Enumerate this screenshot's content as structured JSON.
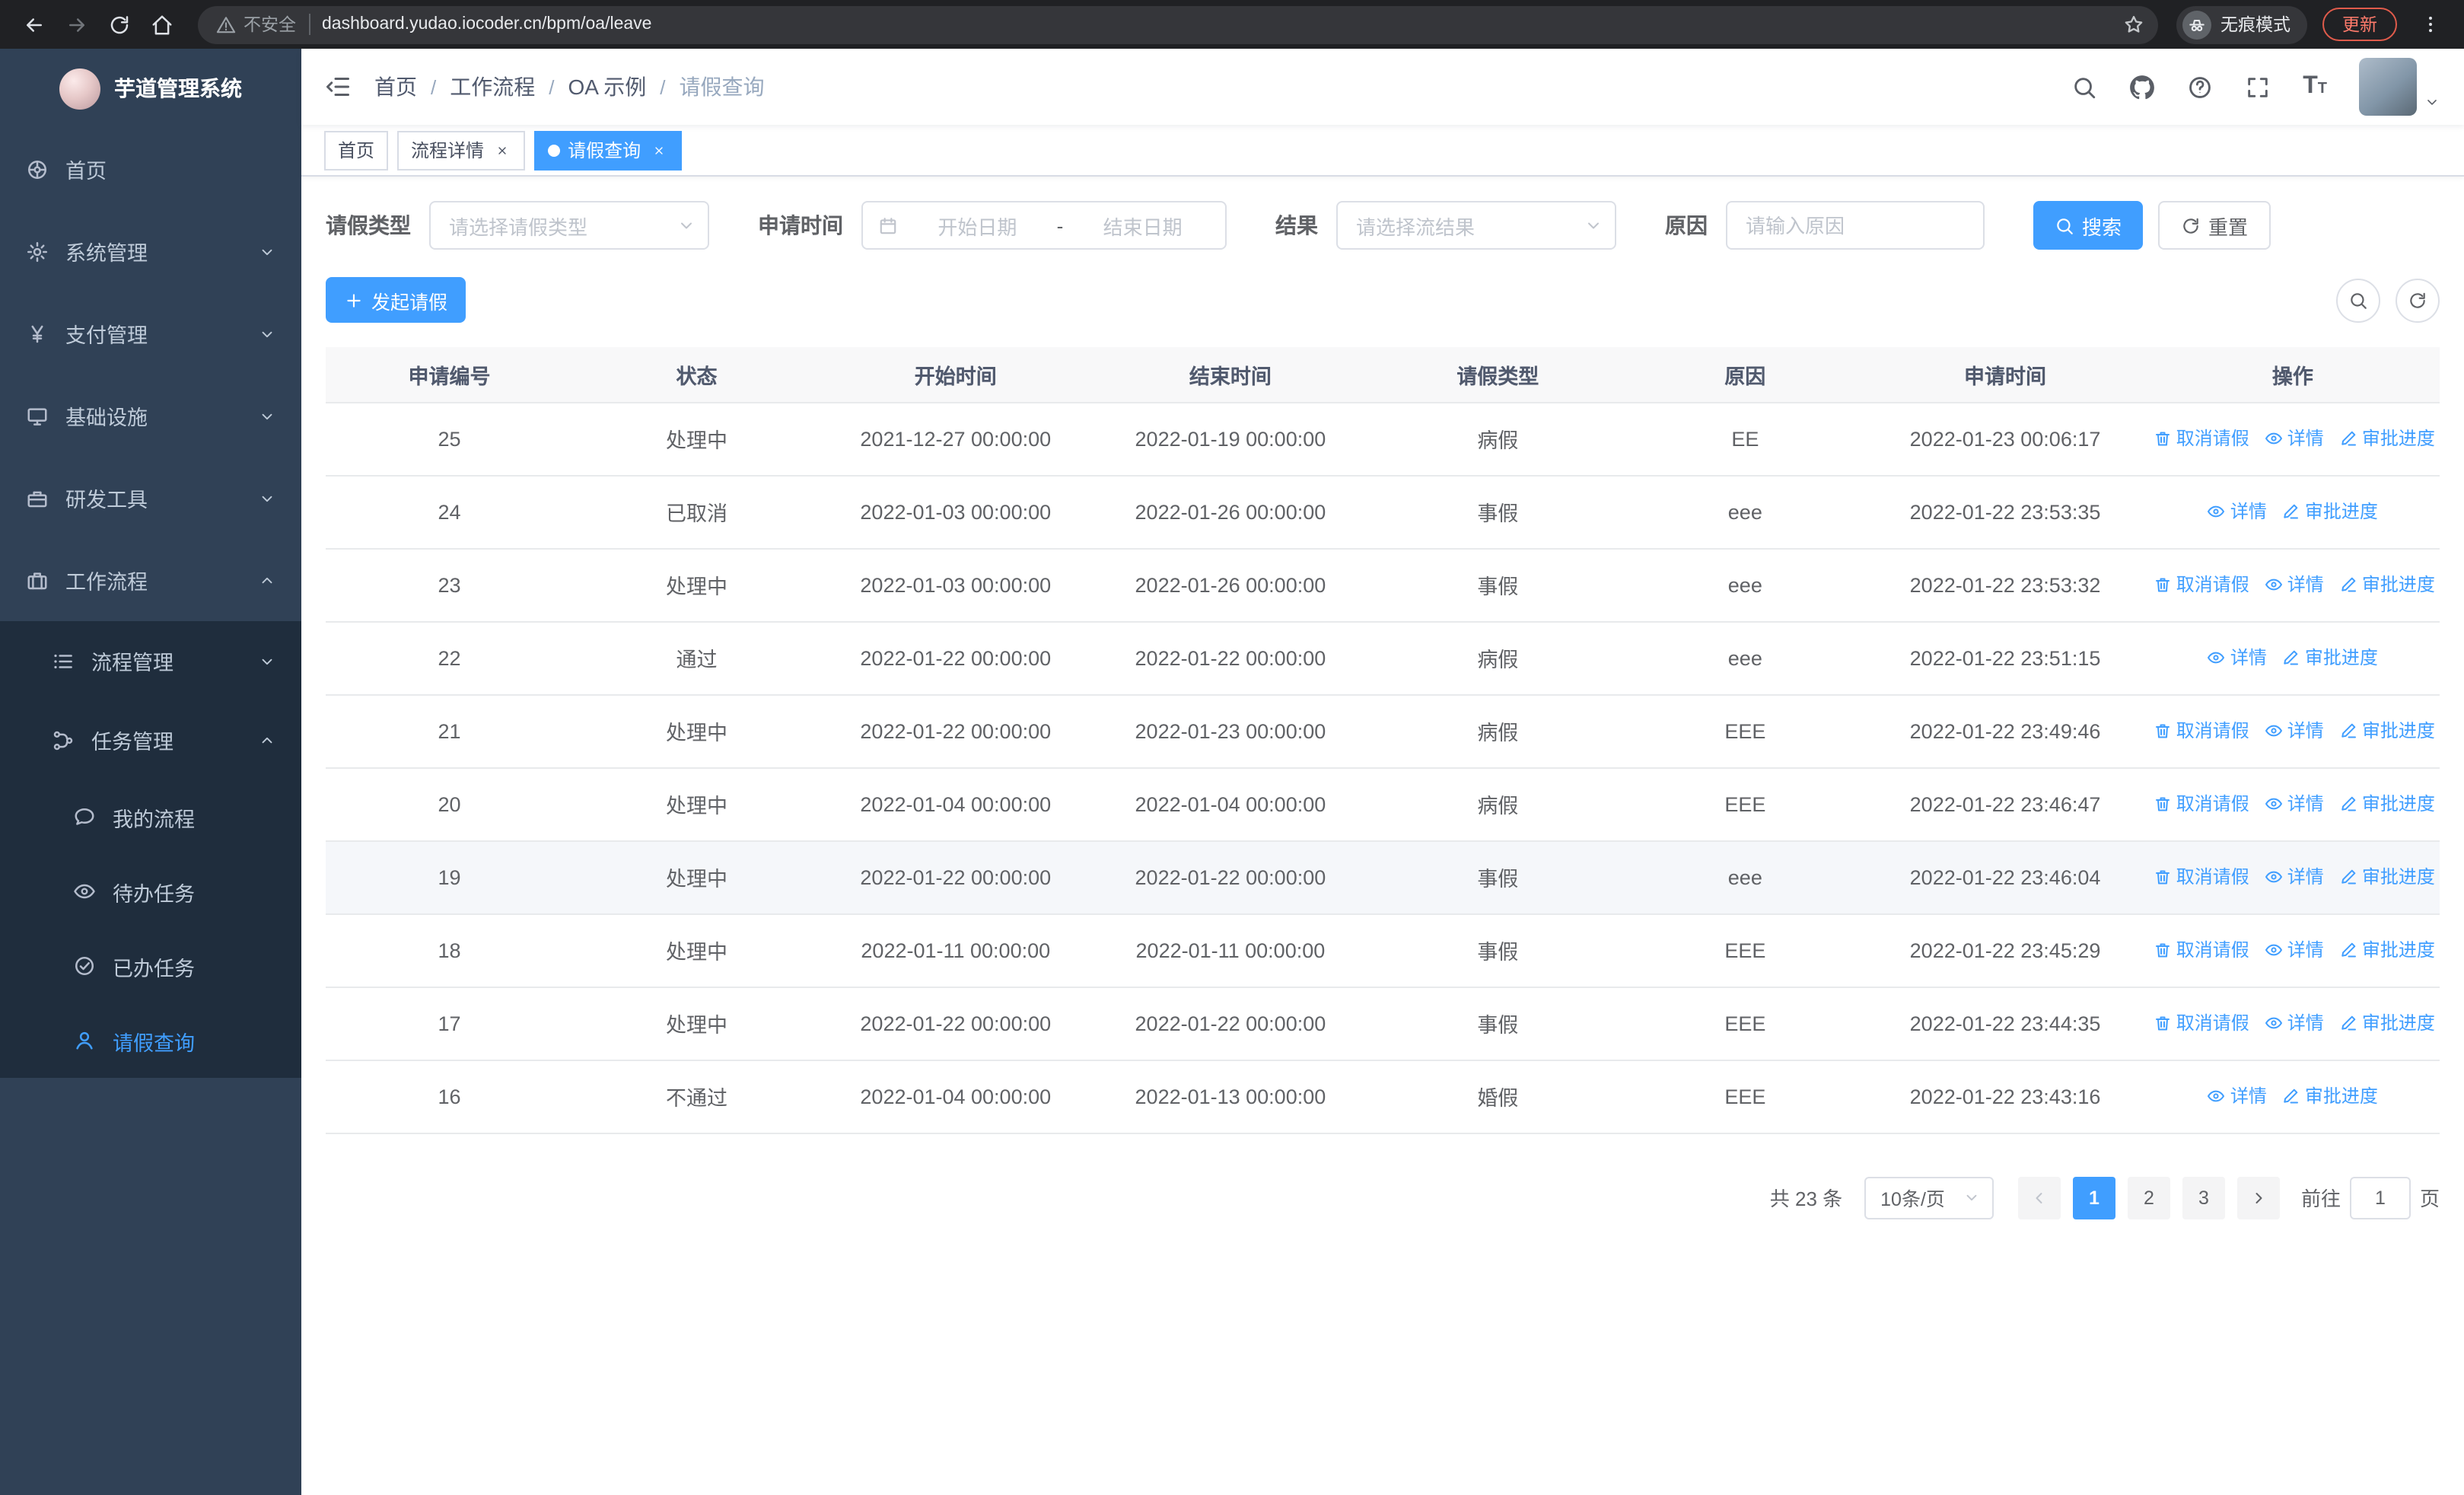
{
  "colors": {
    "primary": "#409eff",
    "sidebar_bg": "#304156",
    "sidebar_submenu_bg": "#1f2d3d",
    "sidebar_text": "#bfcbd9",
    "chrome_bar_bg": "#202124",
    "table_header_bg": "#f8f8f9",
    "update_badge_text": "#ff7b6b"
  },
  "browser": {
    "security_label": "不安全",
    "url": "dashboard.yudao.iocoder.cn/bpm/oa/leave",
    "incognito_label": "无痕模式",
    "update_label": "更新",
    "icons": [
      "back",
      "forward",
      "reload",
      "home",
      "warning",
      "star",
      "incognito",
      "menu-dots"
    ]
  },
  "sidebar": {
    "app_title": "芋道管理系统",
    "items": [
      {
        "label": "首页",
        "icon": "dashboard-icon",
        "has_children": false
      },
      {
        "label": "系统管理",
        "icon": "gear-icon",
        "has_children": true,
        "expanded": false
      },
      {
        "label": "支付管理",
        "icon": "yen-icon",
        "has_children": true,
        "expanded": false
      },
      {
        "label": "基础设施",
        "icon": "monitor-icon",
        "has_children": true,
        "expanded": false
      },
      {
        "label": "研发工具",
        "icon": "toolbox-icon",
        "has_children": true,
        "expanded": false
      },
      {
        "label": "工作流程",
        "icon": "briefcase-icon",
        "has_children": true,
        "expanded": true
      }
    ],
    "workflow_children": [
      {
        "label": "流程管理",
        "icon": "list-icon",
        "has_children": true,
        "expanded": false
      },
      {
        "label": "任务管理",
        "icon": "tree-icon",
        "has_children": true,
        "expanded": true
      }
    ],
    "task_children": [
      {
        "label": "我的流程",
        "icon": "comment-icon",
        "active": false
      },
      {
        "label": "待办任务",
        "icon": "eye-icon",
        "active": false
      },
      {
        "label": "已办任务",
        "icon": "check-icon",
        "active": false
      },
      {
        "label": "请假查询",
        "icon": "user-icon",
        "active": true
      }
    ]
  },
  "header": {
    "breadcrumb": [
      "首页",
      "工作流程",
      "OA 示例",
      "请假查询"
    ],
    "breadcrumb_separator": "/",
    "icons": [
      "search",
      "github",
      "help",
      "fullscreen",
      "font-size",
      "avatar",
      "caret-down"
    ]
  },
  "tabs": [
    {
      "label": "首页",
      "closable": false,
      "active": false
    },
    {
      "label": "流程详情",
      "closable": true,
      "active": false
    },
    {
      "label": "请假查询",
      "closable": true,
      "active": true
    }
  ],
  "filters": {
    "leave_type_label": "请假类型",
    "leave_type_placeholder": "请选择请假类型",
    "apply_time_label": "申请时间",
    "start_date_placeholder": "开始日期",
    "range_separator": "-",
    "end_date_placeholder": "结束日期",
    "result_label": "结果",
    "result_placeholder": "请选择流结果",
    "reason_label": "原因",
    "reason_placeholder": "请输入原因",
    "search_button": "搜索",
    "reset_button": "重置"
  },
  "toolbar": {
    "create_button": "发起请假",
    "icons": [
      "search",
      "refresh"
    ]
  },
  "table": {
    "columns": [
      "申请编号",
      "状态",
      "开始时间",
      "结束时间",
      "请假类型",
      "原因",
      "申请时间",
      "操作"
    ],
    "actions": {
      "cancel": "取消请假",
      "detail": "详情",
      "progress": "审批进度"
    },
    "rows": [
      {
        "id": "25",
        "status": "处理中",
        "start": "2021-12-27 00:00:00",
        "end": "2022-01-19 00:00:00",
        "type": "病假",
        "reason": "EE",
        "applied": "2022-01-23 00:06:17",
        "cancellable": true,
        "highlighted": false
      },
      {
        "id": "24",
        "status": "已取消",
        "start": "2022-01-03 00:00:00",
        "end": "2022-01-26 00:00:00",
        "type": "事假",
        "reason": "eee",
        "applied": "2022-01-22 23:53:35",
        "cancellable": false,
        "highlighted": false
      },
      {
        "id": "23",
        "status": "处理中",
        "start": "2022-01-03 00:00:00",
        "end": "2022-01-26 00:00:00",
        "type": "事假",
        "reason": "eee",
        "applied": "2022-01-22 23:53:32",
        "cancellable": true,
        "highlighted": false
      },
      {
        "id": "22",
        "status": "通过",
        "start": "2022-01-22 00:00:00",
        "end": "2022-01-22 00:00:00",
        "type": "病假",
        "reason": "eee",
        "applied": "2022-01-22 23:51:15",
        "cancellable": false,
        "highlighted": false
      },
      {
        "id": "21",
        "status": "处理中",
        "start": "2022-01-22 00:00:00",
        "end": "2022-01-23 00:00:00",
        "type": "病假",
        "reason": "EEE",
        "applied": "2022-01-22 23:49:46",
        "cancellable": true,
        "highlighted": false
      },
      {
        "id": "20",
        "status": "处理中",
        "start": "2022-01-04 00:00:00",
        "end": "2022-01-04 00:00:00",
        "type": "病假",
        "reason": "EEE",
        "applied": "2022-01-22 23:46:47",
        "cancellable": true,
        "highlighted": false
      },
      {
        "id": "19",
        "status": "处理中",
        "start": "2022-01-22 00:00:00",
        "end": "2022-01-22 00:00:00",
        "type": "事假",
        "reason": "eee",
        "applied": "2022-01-22 23:46:04",
        "cancellable": true,
        "highlighted": true
      },
      {
        "id": "18",
        "status": "处理中",
        "start": "2022-01-11 00:00:00",
        "end": "2022-01-11 00:00:00",
        "type": "事假",
        "reason": "EEE",
        "applied": "2022-01-22 23:45:29",
        "cancellable": true,
        "highlighted": false
      },
      {
        "id": "17",
        "status": "处理中",
        "start": "2022-01-22 00:00:00",
        "end": "2022-01-22 00:00:00",
        "type": "事假",
        "reason": "EEE",
        "applied": "2022-01-22 23:44:35",
        "cancellable": true,
        "highlighted": false
      },
      {
        "id": "16",
        "status": "不通过",
        "start": "2022-01-04 00:00:00",
        "end": "2022-01-13 00:00:00",
        "type": "婚假",
        "reason": "EEE",
        "applied": "2022-01-22 23:43:16",
        "cancellable": false,
        "highlighted": false
      }
    ]
  },
  "pagination": {
    "total_text": "共 23 条",
    "page_size": "10条/页",
    "pages": [
      "1",
      "2",
      "3"
    ],
    "current_page": "1",
    "goto_label": "前往",
    "goto_value": "1",
    "goto_suffix": "页"
  }
}
